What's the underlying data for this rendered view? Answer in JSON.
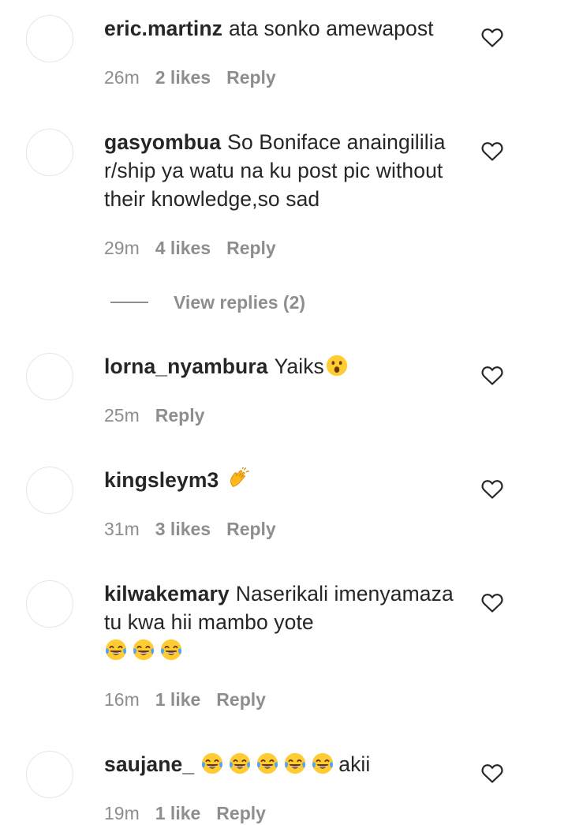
{
  "comments": [
    {
      "username": "eric.martinz",
      "text": "ata sonko amewapost",
      "time": "26m",
      "likes": "2 likes",
      "reply": "Reply"
    },
    {
      "username": "gasyombua",
      "text": "So Boniface anaingililia r/ship ya watu na ku post pic without their knowledge,so sad",
      "time": "29m",
      "likes": "4 likes",
      "reply": "Reply"
    },
    {
      "username": "lorna_nyambura",
      "text": "Yaiks",
      "emoji": "astonished-face",
      "time": "25m",
      "likes": "",
      "reply": "Reply"
    },
    {
      "username": "kingsleym3",
      "text": "",
      "emoji": "clapping-hands",
      "time": "31m",
      "likes": "3 likes",
      "reply": "Reply"
    },
    {
      "username": "kilwakemary",
      "text": "Naserikali imenyamaza tu kwa hii mambo yote",
      "emoji": "tears-of-joy x3",
      "time": "16m",
      "likes": "1 like",
      "reply": "Reply"
    },
    {
      "username": "saujane_",
      "text": "akii",
      "emoji": "tears-of-joy x5",
      "time": "19m",
      "likes": "1 like",
      "reply": "Reply"
    }
  ],
  "view_replies": {
    "label": "View replies (2)"
  },
  "icons": {
    "like": "heart-outline-icon"
  },
  "colors": {
    "text": "#262626",
    "secondary": "#8e8e8e",
    "avatar_border": "#e6e6e6"
  }
}
